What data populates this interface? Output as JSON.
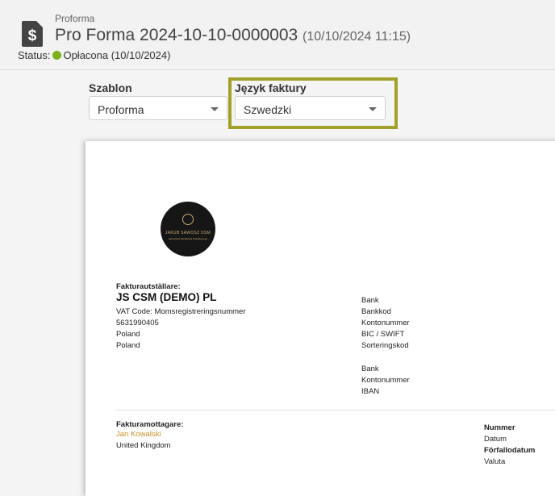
{
  "header": {
    "breadcrumb": "Proforma",
    "title": "Pro Forma 2024-10-10-0000003",
    "timestamp": "(10/10/2024 11:15)",
    "status_label": "Status:",
    "status_value": "Opłacona (10/10/2024)",
    "status_color": "#7ab317"
  },
  "controls": {
    "template_label": "Szablon",
    "template_value": "Proforma",
    "language_label": "Język faktury",
    "language_value": "Szwedzki",
    "highlight_color": "#a3a02a"
  },
  "invoice": {
    "logo_text": "JAKUB SAWOSZ DSM",
    "logo_sub": "Kancelaria Doradztwa Podatkowego",
    "issuer_label": "Fakturautställare:",
    "issuer_name": "JS CSM (DEMO) PL",
    "issuer_lines": [
      "VAT Code: Momsregistreringsnummer",
      "5631990405",
      "Poland",
      "Poland"
    ],
    "bank_lines_1": [
      "Bank",
      "Bankkod",
      "Kontonummer",
      "BIC / SWIFT",
      "Sorteringskod"
    ],
    "bank_lines_2": [
      "Bank",
      "Kontonummer",
      "IBAN"
    ],
    "recipient_label": "Fakturamottagare:",
    "recipient_name": "Jan Kowalski",
    "recipient_country": "United Kingdom",
    "meta": {
      "number_label": "Nummer",
      "date_label": "Datum",
      "due_label": "Förfallodatum",
      "currency_label": "Valuta"
    }
  }
}
